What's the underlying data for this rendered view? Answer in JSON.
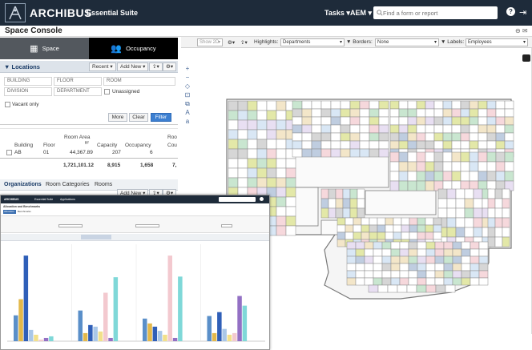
{
  "header": {
    "brand": "ARCHIBUS",
    "suite": "Essential Suite",
    "tasks": "Tasks ▾",
    "user": "AEM ▾",
    "search_placeholder": "Find a form or report",
    "help": "?",
    "logout": "⇥"
  },
  "page": {
    "title": "Space Console",
    "icons": "⊖ ✉"
  },
  "tabs": {
    "space": "Space",
    "occupancy": "Occupancy"
  },
  "locations": {
    "title": "Locations",
    "recent": "Recent ▾",
    "add_new": "Add New ▾",
    "export": "⇪▾",
    "settings": "⚙▾",
    "fields": {
      "building": "BUILDING",
      "floor": "FLOOR",
      "room": "ROOM",
      "division": "DIVISION",
      "department": "DEPARTMENT"
    },
    "unassigned": "Unassigned",
    "vacant_only": "Vacant only",
    "more": "More",
    "clear": "Clear",
    "filter": "Filter"
  },
  "table": {
    "headers": {
      "building": "Building",
      "floor": "Floor",
      "room_area": "Room Area",
      "room_area_unit": "ft²",
      "capacity": "Capacity",
      "occupancy": "Occupancy",
      "room_count_1": "Roo",
      "room_count_2": "Cou"
    },
    "row": {
      "building": "AB",
      "floor": "01",
      "room_area": "44,367.89",
      "capacity": "207",
      "occupancy": "6"
    },
    "totals": {
      "room_area": "1,721,101.12",
      "capacity": "8,915",
      "occupancy": "1,658",
      "rooms": "7,"
    }
  },
  "subtabs": {
    "organizations": "Organizations",
    "room_categories": "Room Categories",
    "rooms": "Rooms",
    "add_new": "Add New ▾"
  },
  "map_toolbar": {
    "show_2d": "Show 2D",
    "gear": "⚙▾",
    "export": "⇪▾",
    "highlights_label": "Highlights:",
    "highlights_value": "Departments",
    "borders_label": "Borders:",
    "borders_value": "None",
    "labels_label": "Labels:",
    "labels_value": "Employees"
  },
  "map_tools": [
    "+",
    "−",
    "◇",
    "⊡",
    "⧉",
    "A",
    "a"
  ],
  "overlay": {
    "brand": "ARCHIBUS",
    "suite": "Essential Suite",
    "apps": "Applications",
    "title": "Allocation and Benchmarks",
    "tabs": [
      "Allocation",
      "Benchmarks"
    ]
  },
  "chart_data": {
    "type": "bar",
    "categories": [
      "",
      "",
      "",
      ""
    ],
    "series": [
      {
        "values": [
          80,
          95,
          70,
          78
        ]
      },
      {
        "values": [
          130,
          25,
          55,
          25
        ]
      },
      {
        "values": [
          265,
          50,
          45,
          90
        ]
      },
      {
        "values": [
          35,
          45,
          32,
          38
        ]
      },
      {
        "values": [
          20,
          30,
          20,
          20
        ]
      },
      {
        "values": [
          5,
          150,
          265,
          25
        ]
      },
      {
        "values": [
          10,
          10,
          10,
          140
        ]
      },
      {
        "values": [
          15,
          198,
          200,
          110
        ]
      }
    ],
    "colors": [
      "#5a8fc9",
      "#e3b84a",
      "#2f5fb8",
      "#a9c7e8",
      "#f2e08a",
      "#f3c9cf",
      "#9370c4",
      "#7fd8d8"
    ],
    "ylim": [
      0,
      300
    ]
  }
}
